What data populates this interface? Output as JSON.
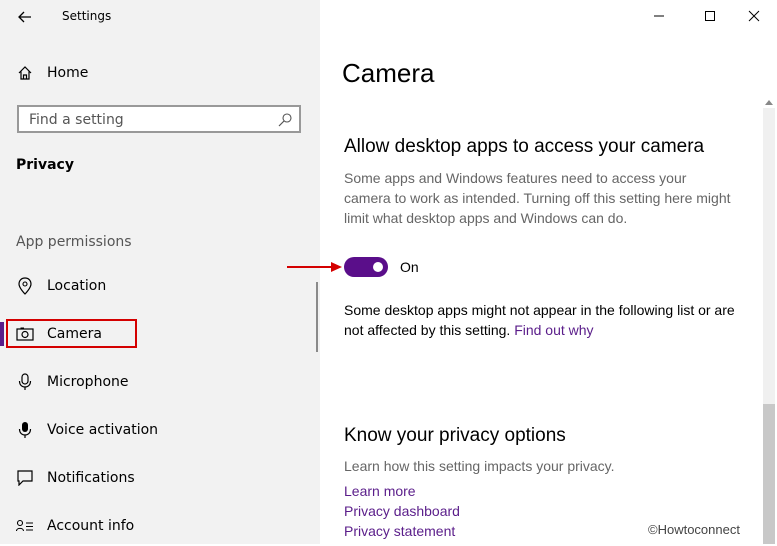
{
  "window": {
    "title": "Settings"
  },
  "sidebar": {
    "home_label": "Home",
    "search_placeholder": "Find a setting",
    "category": "Privacy",
    "section_label": "App permissions",
    "items": [
      {
        "label": "Location",
        "icon": "location-icon"
      },
      {
        "label": "Camera",
        "icon": "camera-icon",
        "selected": true
      },
      {
        "label": "Microphone",
        "icon": "microphone-icon"
      },
      {
        "label": "Voice activation",
        "icon": "voice-activation-icon"
      },
      {
        "label": "Notifications",
        "icon": "notifications-icon"
      },
      {
        "label": "Account info",
        "icon": "account-info-icon"
      }
    ]
  },
  "main": {
    "page_title": "Camera",
    "desktop_section": {
      "title": "Allow desktop apps to access your camera",
      "description": "Some apps and Windows features need to access your camera to work as intended. Turning off this setting here might limit what desktop apps and Windows can do.",
      "toggle_state": "On",
      "toggle_on": true,
      "note": "Some desktop apps might not appear in the following list or are not affected by this setting.",
      "note_link": "Find out why"
    },
    "privacy_section": {
      "title": "Know your privacy options",
      "description": "Learn how this setting impacts your privacy.",
      "links": [
        "Learn more",
        "Privacy dashboard",
        "Privacy statement"
      ]
    }
  },
  "watermark": "©Howtoconnect",
  "colors": {
    "accent": "#5a0e8a",
    "link": "#5a1d8a",
    "highlight": "#d40000",
    "sidebar_bg": "#f2f2f2"
  }
}
